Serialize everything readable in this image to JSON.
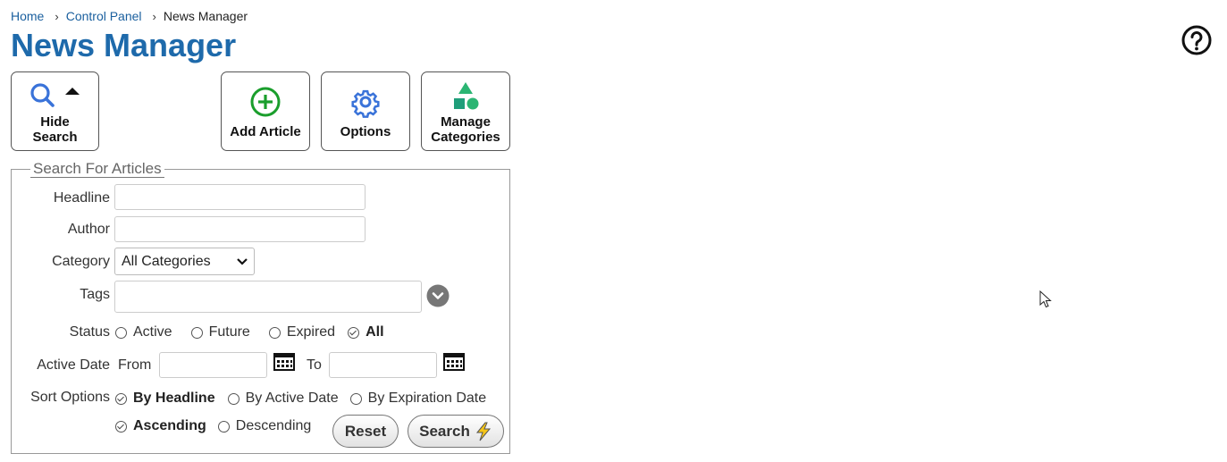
{
  "breadcrumb": {
    "items": [
      "Home",
      "Control Panel"
    ],
    "current": "News Manager"
  },
  "page": {
    "title": "News Manager"
  },
  "toolbar": {
    "hide_search": [
      "Hide",
      "Search"
    ],
    "add_article": "Add Article",
    "options": "Options",
    "manage_categories": [
      "Manage",
      "Categories"
    ]
  },
  "search": {
    "legend": "Search For Articles",
    "headline_label": "Headline",
    "headline_value": "",
    "author_label": "Author",
    "author_value": "",
    "category_label": "Category",
    "category_selected": "All Categories",
    "tags_label": "Tags",
    "tags_value": "",
    "status_label": "Status",
    "status_options": [
      "Active",
      "Future",
      "Expired",
      "All"
    ],
    "status_selected": "All",
    "active_date_label": "Active Date",
    "from_label": "From",
    "from_value": "",
    "to_label": "To",
    "to_value": "",
    "sort_label": "Sort Options",
    "sort_options": [
      "By Headline",
      "By Active Date",
      "By Expiration Date"
    ],
    "sort_selected": "By Headline",
    "order_options": [
      "Ascending",
      "Descending"
    ],
    "order_selected": "Ascending",
    "reset_label": "Reset",
    "search_label": "Search"
  },
  "colors": {
    "title_blue": "#1e6aab",
    "link_blue": "#1a5f9e",
    "add_green": "#1a9e2c",
    "options_blue": "#3a73d9",
    "categories_green": "#2bb573",
    "bolt_yellow": "#f5c518"
  },
  "icons": {
    "help": "question-circle-icon",
    "search": "magnifier-icon",
    "collapse": "caret-up-icon",
    "add": "plus-circle-icon",
    "options": "gear-icon",
    "categories": "shapes-icon",
    "calendar": "calendar-icon",
    "tags_toggle": "chevron-down-circle-icon",
    "search_go": "lightning-bolt-icon"
  }
}
